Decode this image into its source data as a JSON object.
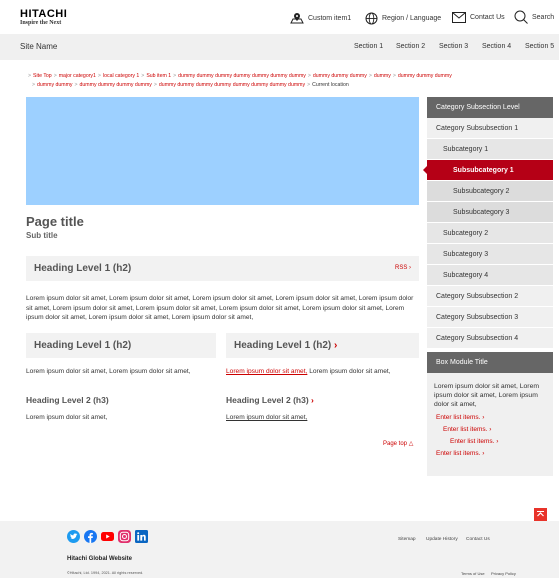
{
  "header": {
    "logo_brand": "HITACHI",
    "logo_tagline": "Inspire the Next",
    "custom_item": "Custom item1",
    "region": "Region / Language",
    "contact": "Contact Us",
    "search": "Search"
  },
  "nav": {
    "site_name": "Site Name",
    "sections": [
      "Section 1",
      "Section 2",
      "Section 3",
      "Section 4",
      "Section 5"
    ]
  },
  "breadcrumb": {
    "row1": [
      "Site Top",
      "major category1",
      "local category 1",
      "Sub item 1",
      "dummy dummy dummy dummy dummy dummy dummy",
      "dummy dummy dummy",
      "dummy",
      "dummy dummy dummy"
    ],
    "row2": [
      "dummy dummy",
      "dummy dummy dummy dummy",
      "dummy dummy dummy dummy dummy dummy dummy dummy"
    ],
    "current": "Current location"
  },
  "page": {
    "title": "Page title",
    "subtitle": "Sub title",
    "h2_main": "Heading Level 1 (h2)",
    "rss": "RSS",
    "para_main": "Lorem ipsum dolor sit amet, Lorem ipsum dolor sit amet, Lorem ipsum dolor sit amet, Lorem ipsum dolor sit amet, Lorem ipsum dolor sit amet, Lorem ipsum dolor sit amet, Lorem ipsum dolor sit amet, Lorem ipsum dolor sit amet, Lorem ipsum dolor sit amet, Lorem ipsum dolor sit amet, Lorem ipsum dolor sit amet, Lorem ipsum dolor sit amet,",
    "left": {
      "h2": "Heading Level 1 (h2)",
      "para": "Lorem ipsum dolor sit amet, Lorem ipsum dolor sit amet,",
      "h3": "Heading Level 2 (h3)",
      "para2": "Lorem ipsum dolor sit amet,"
    },
    "right": {
      "h2": "Heading Level 1 (h2)",
      "para_link": "Lorem ipsum dolor sit amet,",
      "para_rest": " Lorem ipsum dolor sit amet,",
      "h3": "Heading Level 2 (h3)",
      "para2_link": "Lorem ipsum dolor sit amet,"
    },
    "page_top": "Page top"
  },
  "sidebar": {
    "header": "Category Subsection Level",
    "items": [
      {
        "label": "Category Subsubsection 1",
        "level": 1
      },
      {
        "label": "Subcategory 1",
        "level": 2
      },
      {
        "label": "Subsubcategory 1",
        "level": 3,
        "active": true
      },
      {
        "label": "Subsubcategory 2",
        "level": 3
      },
      {
        "label": "Subsubcategory 3",
        "level": 3
      },
      {
        "label": "Subcategory 2",
        "level": 2
      },
      {
        "label": "Subcategory 3",
        "level": 2
      },
      {
        "label": "Subcategory 4",
        "level": 2
      },
      {
        "label": "Category Subsubsection 2",
        "level": 1
      },
      {
        "label": "Category Subsubsection 3",
        "level": 1
      },
      {
        "label": "Category Subsubsection 4",
        "level": 1
      }
    ]
  },
  "box": {
    "title": "Box Module Title",
    "para": "Lorem ipsum dolor sit amet, Lorem ipsum dolor sit amet, Lorem ipsum dolor sit amet,",
    "list": [
      "Enter list items.",
      "Enter list items.",
      "Enter list items.",
      "Enter list items."
    ]
  },
  "footer": {
    "site": "Hitachi Global Website",
    "copyright": "©Hitachi, Ltd. 1994, 2021. All rights reserved.",
    "links": [
      "Sitemap",
      "Update History",
      "Contact Us"
    ],
    "sublinks": [
      "Terms of Use",
      "Privacy Policy"
    ]
  },
  "colors": {
    "accent": "#cc0000",
    "active": "#b50016",
    "hero": "#9dd0ff",
    "sidebar_header": "#666666"
  }
}
